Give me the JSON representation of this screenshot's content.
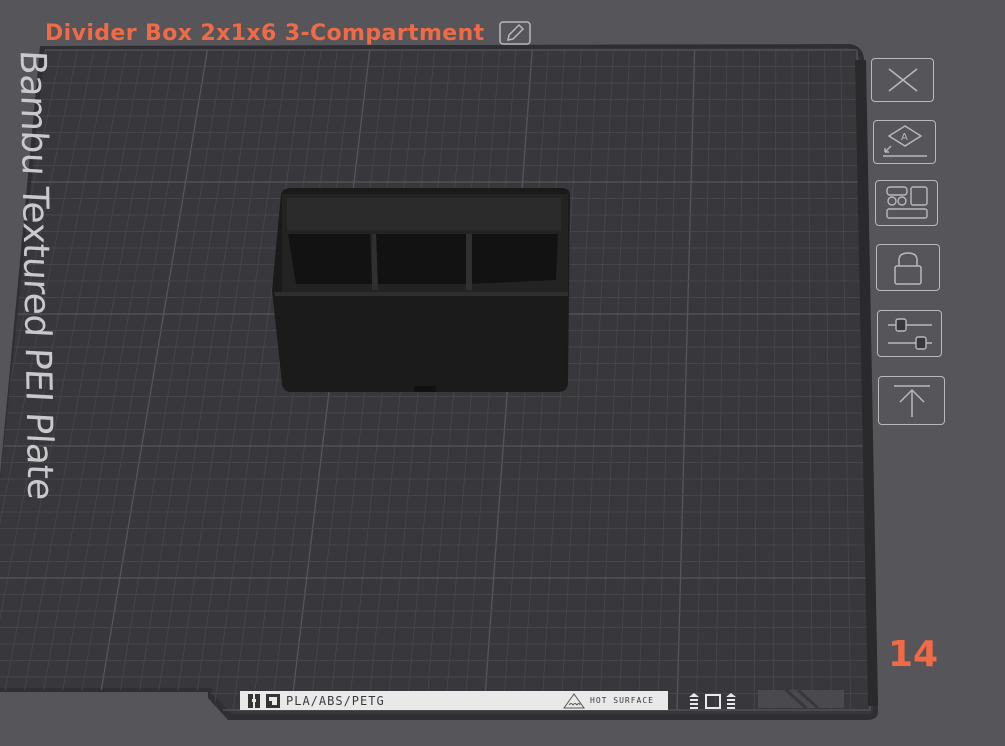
{
  "plate": {
    "title": "Divider Box 2x1x6 3-Compartment",
    "bed_label": "Bambu Textured PEI Plate",
    "number": "14"
  },
  "bottom_strip": {
    "materials": "PLA/ABS/PETG",
    "warning": "HOT SURFACE"
  },
  "toolbar": {
    "buttons": [
      "close-icon",
      "auto-orient-icon",
      "arrange-icon",
      "lock-icon",
      "settings-sliders-icon",
      "move-to-top-icon"
    ]
  },
  "colors": {
    "accent": "#f06a45",
    "background": "#55555a",
    "bed": "#38383c",
    "model": "#1c1c1c"
  }
}
